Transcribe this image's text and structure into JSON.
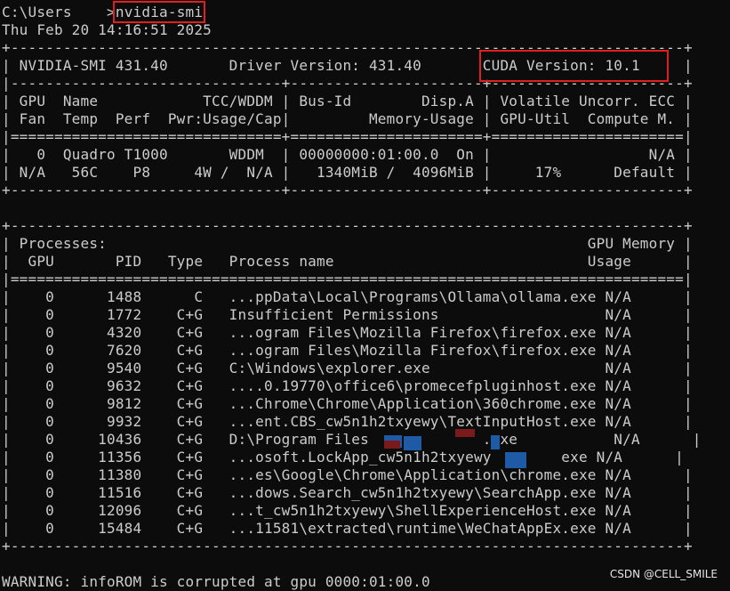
{
  "prompt": {
    "path": "C:\\Users",
    "redacted_gap": "    ",
    "command": "nvidia-smi"
  },
  "timestamp": "Thu Feb 20 14:16:51 2025",
  "lines": [
    "+-----------------------------------------------------------------------------+",
    "| NVIDIA-SMI 431.40       Driver Version: 431.40       CUDA Version: 10.1     |",
    "|-------------------------------+----------------------+----------------------+",
    "| GPU  Name            TCC/WDDM | Bus-Id        Disp.A | Volatile Uncorr. ECC |",
    "| Fan  Temp  Perf  Pwr:Usage/Cap|         Memory-Usage | GPU-Util  Compute M. |",
    "|===============================+======================+======================|",
    "|   0  Quadro T1000       WDDM  | 00000000:01:00.0  On |                  N/A |",
    "| N/A   56C    P8     4W /  N/A |   1340MiB /  4096MiB |     17%      Default |",
    "+-------------------------------+----------------------+----------------------+",
    "",
    "+-----------------------------------------------------------------------------+",
    "| Processes:                                                       GPU Memory |",
    "|  GPU       PID   Type   Process name                             Usage      |",
    "|=============================================================================|",
    "|    0      1488      C   ...ppData\\Local\\Programs\\Ollama\\ollama.exe N/A      |",
    "|    0      1772    C+G   Insufficient Permissions                   N/A      |",
    "|    0      4320    C+G   ...ogram Files\\Mozilla Firefox\\firefox.exe N/A      |",
    "|    0      7620    C+G   ...ogram Files\\Mozilla Firefox\\firefox.exe N/A      |",
    "|    0      9540    C+G   C:\\Windows\\explorer.exe                    N/A      |",
    "|    0      9632    C+G   ....0.19770\\office6\\promecefpluginhost.exe N/A      |",
    "|    0      9812    C+G   ...Chrome\\Chrome\\Application\\360chrome.exe N/A      |",
    "|    0      9932    C+G   ...ent.CBS_cw5n1h2txyewy\\TextInputHost.exe N/A      |",
    "|    0     10436    C+G   D:\\Program Files             .exe           N/A      |",
    "|    0     11356    C+G   ...osoft.LockApp_cw5n1h2txyewy        exe N/A      |",
    "|    0     11380    C+G   ...es\\Google\\Chrome\\Application\\chrome.exe N/A      |",
    "|    0     11516    C+G   ...dows.Search_cw5n1h2txyewy\\SearchApp.exe N/A      |",
    "|    0     12096    C+G   ...t_cw5n1h2txyewy\\ShellExperienceHost.exe N/A      |",
    "|    0     15484    C+G   ...11581\\extracted\\runtime\\WeChatAppEx.exe N/A      |",
    "+-----------------------------------------------------------------------------+"
  ],
  "warning": "WARNING: infoROM is corrupted at gpu 0000:01:00.0",
  "watermark": "CSDN @CELL_SMILE",
  "colors": {
    "background": "#0c0c0c",
    "text": "#cccccc",
    "highlight_box": "#e02020",
    "redaction_blue": "#1f5aa6",
    "redaction_red": "#7a1a1a"
  }
}
